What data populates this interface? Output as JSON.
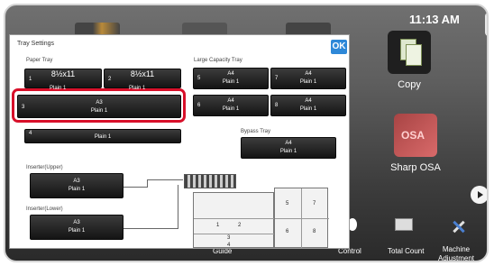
{
  "status": {
    "time": "11:13 AM"
  },
  "home": {
    "apps": [
      {
        "label": "Copy"
      },
      {
        "label": "Sharp OSA"
      }
    ],
    "bottom": [
      {
        "label": "Guide"
      },
      {
        "label": "Control"
      },
      {
        "label": "Total Count"
      },
      {
        "label": "Machine\nAdjustment"
      }
    ]
  },
  "dialog": {
    "title": "Tray Settings",
    "ok_label": "OK",
    "sections": {
      "paper_tray": "Paper Tray",
      "large_capacity": "Large Capacity Tray",
      "bypass": "Bypass Tray",
      "inserter_upper": "Inserter(Upper)",
      "inserter_lower": "Inserter(Lower)"
    },
    "trays": {
      "t1": {
        "num": "1",
        "size": "8½x11",
        "type": "Plain 1"
      },
      "t2": {
        "num": "2",
        "size": "8½x11",
        "type": "Plain 1"
      },
      "t3": {
        "num": "3",
        "size": "A3",
        "type": "Plain 1"
      },
      "t4": {
        "num": "4",
        "size": "",
        "type": "Plain 1"
      },
      "t5": {
        "num": "5",
        "size": "A4",
        "type": "Plain 1"
      },
      "t6": {
        "num": "6",
        "size": "A4",
        "type": "Plain 1"
      },
      "t7": {
        "num": "7",
        "size": "A4",
        "type": "Plain 1"
      },
      "t8": {
        "num": "8",
        "size": "A4",
        "type": "Plain 1"
      },
      "bypass": {
        "size": "A4",
        "type": "Plain 1"
      },
      "ins_upper": {
        "size": "A3",
        "type": "Plain 1"
      },
      "ins_lower": {
        "size": "A3",
        "type": "Plain 1"
      }
    },
    "diagram": {
      "cells": [
        "1",
        "2",
        "3",
        "4",
        "5",
        "6",
        "7",
        "8"
      ]
    }
  },
  "colors": {
    "highlight": "#d8102a",
    "ok": "#2e88d8"
  }
}
